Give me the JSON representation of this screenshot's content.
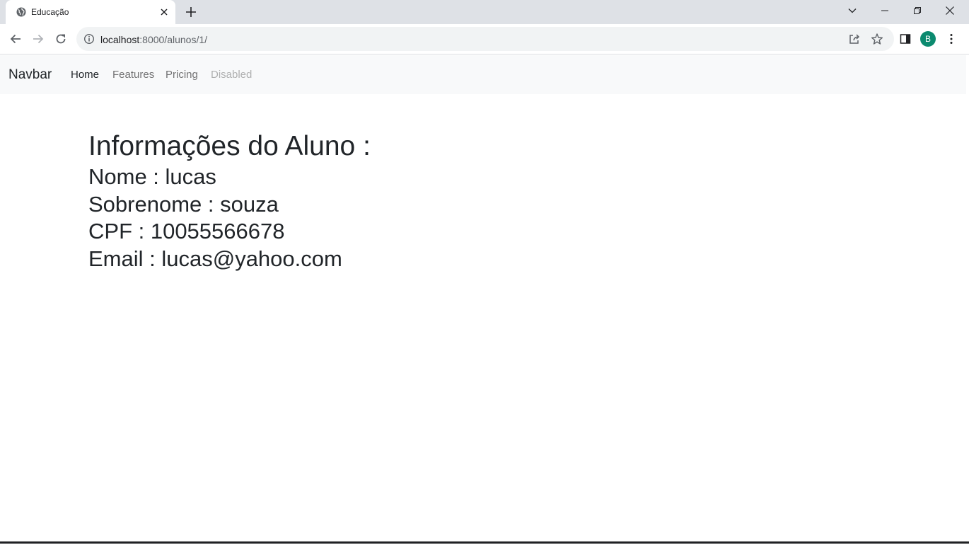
{
  "browser": {
    "tab_title": "Educação",
    "url_host": "localhost",
    "url_rest": ":8000/alunos/1/",
    "profile_initial": "B"
  },
  "navbar": {
    "brand": "Navbar",
    "links": [
      {
        "label": "Home",
        "state": "active"
      },
      {
        "label": "Features",
        "state": "normal"
      },
      {
        "label": "Pricing",
        "state": "normal"
      },
      {
        "label": "Disabled",
        "state": "disabled"
      }
    ]
  },
  "student": {
    "heading": "Informações do Aluno :",
    "nome": "Nome : lucas",
    "sobrenome": "Sobrenome : souza",
    "cpf": "CPF : 10055566678",
    "email": "Email : lucas@yahoo.com"
  },
  "colors": {
    "tabstrip": "#dee1e6",
    "omnibox": "#f1f3f4",
    "navbar_bg": "#f8f9fa",
    "text": "#212529",
    "avatar": "#0b8a6f"
  }
}
